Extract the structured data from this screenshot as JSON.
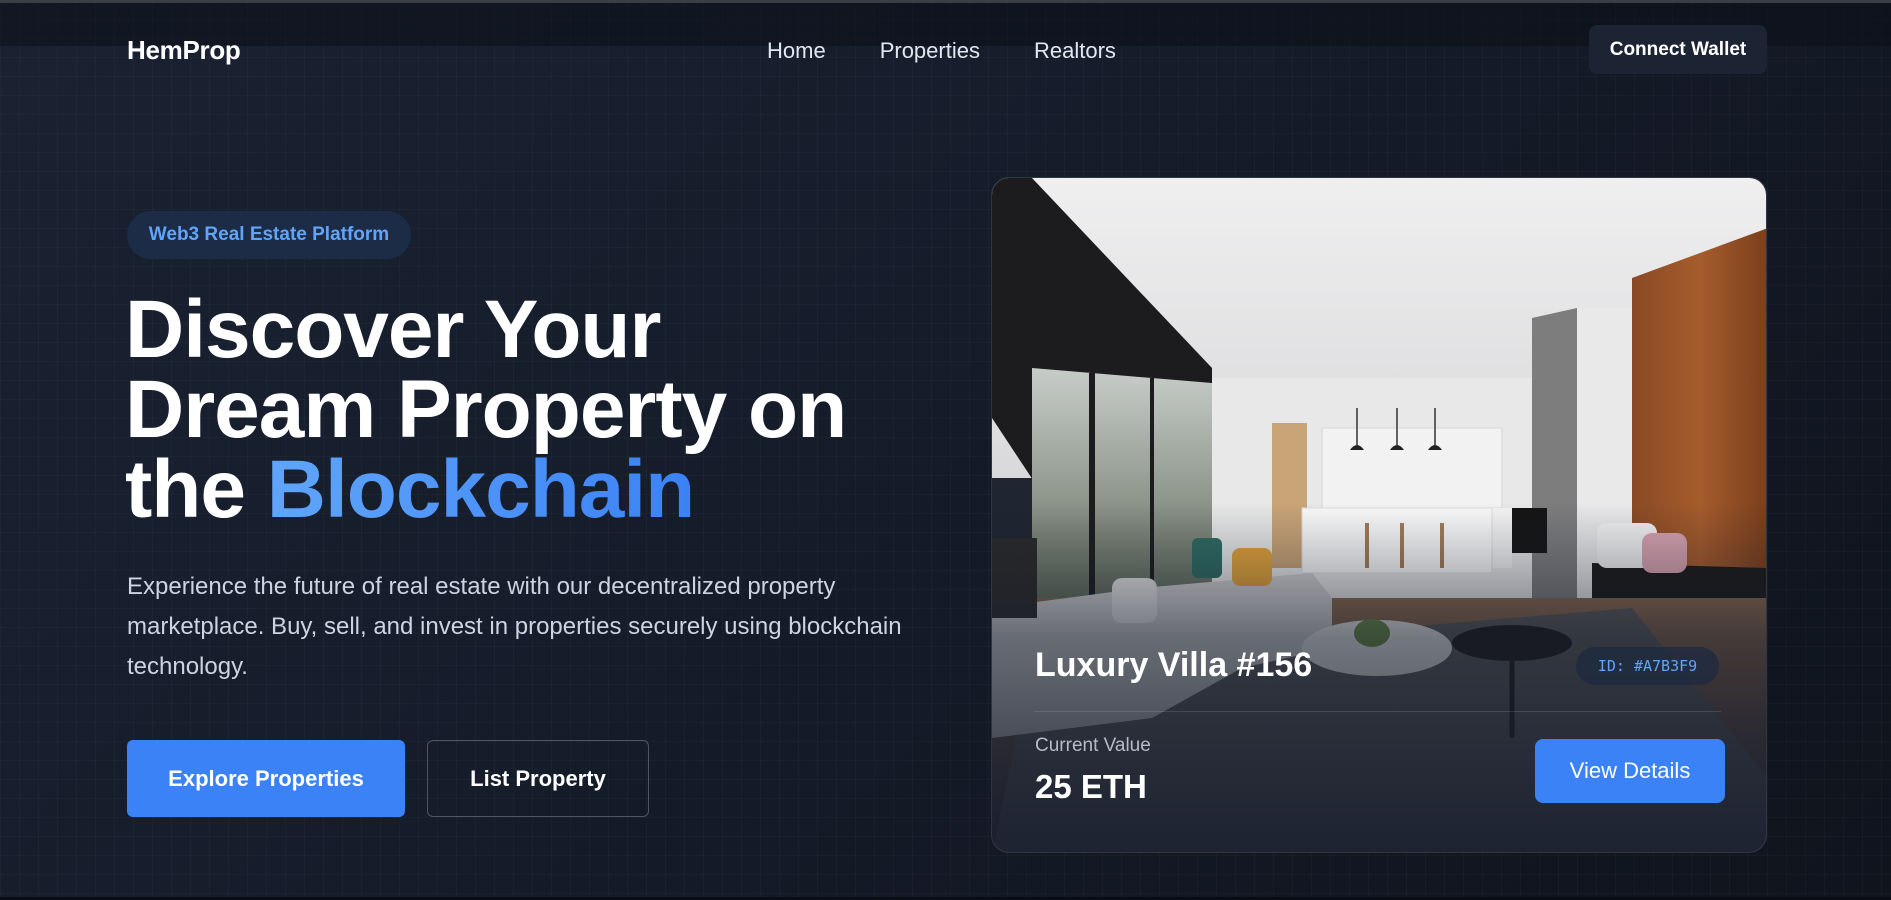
{
  "header": {
    "logo": "HemProp",
    "nav": [
      "Home",
      "Properties",
      "Realtors"
    ],
    "connect_wallet": "Connect Wallet"
  },
  "hero": {
    "badge": "Web3 Real Estate Platform",
    "headline_line1": "Discover Your",
    "headline_line2": "Dream Property on",
    "headline_line3_prefix": "the ",
    "headline_accent": "Blockchain",
    "description": "Experience the future of real estate with our decentralized property marketplace. Buy, sell, and invest in properties securely using blockchain technology.",
    "primary_button": "Explore Properties",
    "secondary_button": "List Property"
  },
  "property_card": {
    "title": "Luxury Villa #156",
    "id_label": "ID: #A7B3F9",
    "value_label": "Current Value",
    "value": "25 ETH",
    "button": "View Details"
  },
  "colors": {
    "background": "#121826",
    "accent": "#3b82f6",
    "accent_light": "#60a5fa",
    "badge_bg": "#1c2b46"
  }
}
